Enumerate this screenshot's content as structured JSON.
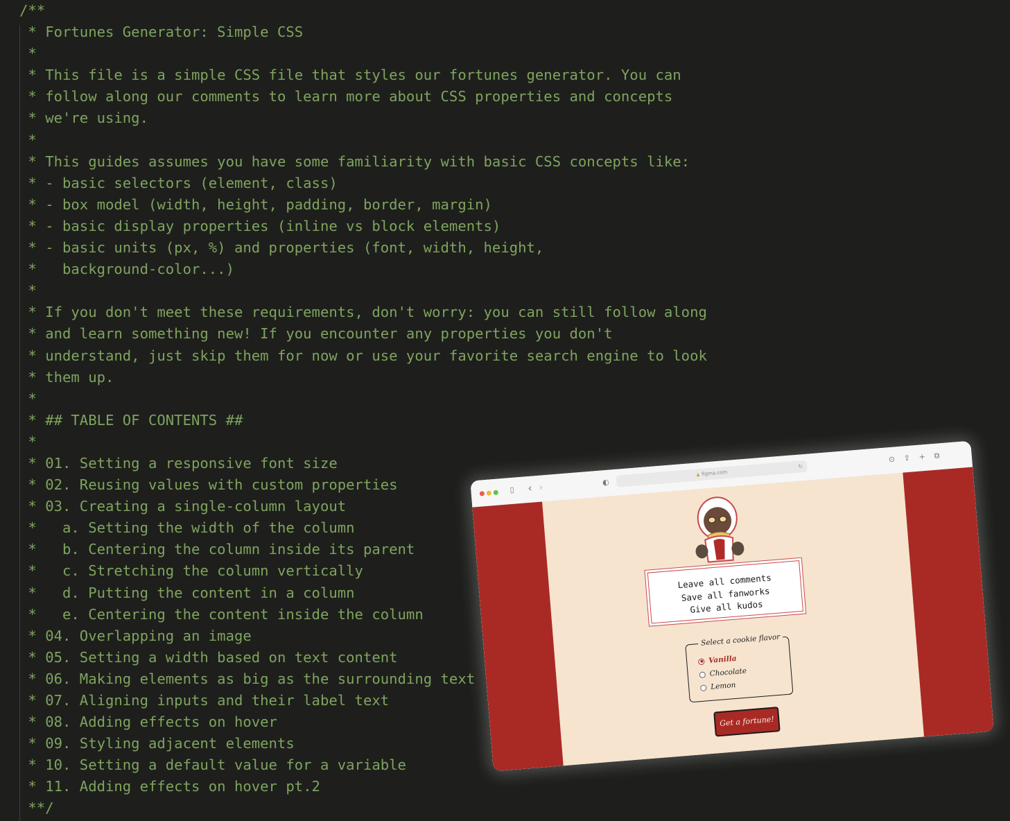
{
  "code": {
    "lines": [
      "/**",
      " * Fortunes Generator: Simple CSS",
      " *",
      " * This file is a simple CSS file that styles our fortunes generator. You can",
      " * follow along our comments to learn more about CSS properties and concepts",
      " * we're using.",
      " *",
      " * This guides assumes you have some familiarity with basic CSS concepts like:",
      " * - basic selectors (element, class)",
      " * - box model (width, height, padding, border, margin)",
      " * - basic display properties (inline vs block elements)",
      " * - basic units (px, %) and properties (font, width, height,",
      " *   background-color...)",
      " *",
      " * If you don't meet these requirements, don't worry: you can still follow along",
      " * and learn something new! If you encounter any properties you don't",
      " * understand, just skip them for now or use your favorite search engine to look",
      " * them up.",
      " *",
      " * ## TABLE OF CONTENTS ##",
      " *",
      " * 01. Setting a responsive font size",
      " * 02. Reusing values with custom properties",
      " * 03. Creating a single-column layout",
      " *   a. Setting the width of the column",
      " *   b. Centering the column inside its parent",
      " *   c. Stretching the column vertically",
      " *   d. Putting the content in a column",
      " *   e. Centering the content inside the column",
      " * 04. Overlapping an image",
      " * 05. Setting a width based on text content",
      " * 06. Making elements as big as the surrounding text",
      " * 07. Aligning inputs and their label text",
      " * 08. Adding effects on hover",
      " * 09. Styling adjacent elements",
      " * 10. Setting a default value for a variable",
      " * 11. Adding effects on hover pt.2",
      " **/"
    ]
  },
  "browser": {
    "url": "figma.com",
    "icons": {
      "sidebar": "sidebar-icon",
      "back": "chevron-left-icon",
      "forward": "chevron-right-icon",
      "shield": "shield-icon",
      "reload": "reload-icon",
      "download": "download-icon",
      "share": "share-icon",
      "new_tab": "plus-icon",
      "tabs": "tabs-icon"
    },
    "glyphs": {
      "sidebar": "▯",
      "back": "‹",
      "forward": "›",
      "shield": "◐",
      "reload": "↻",
      "download": "⊙",
      "share": "⇪",
      "new_tab": "+",
      "tabs": "⧉"
    },
    "lock": "🔒",
    "page": {
      "fortune_lines": [
        "Leave all comments",
        "Save all fanworks",
        "Give all kudos"
      ],
      "flavor_legend": "Select a cookie flavor",
      "flavors": [
        "Vanilla",
        "Chocolate",
        "Lemon"
      ],
      "selected_flavor": "Vanilla",
      "button_label": "Get a fortune!"
    }
  },
  "colors": {
    "editor_bg": "#1e1f1c",
    "comment": "#7fa35f",
    "page_bg": "#f6e4cf",
    "side_panel": "#a92a25",
    "button": "#a92a25"
  }
}
